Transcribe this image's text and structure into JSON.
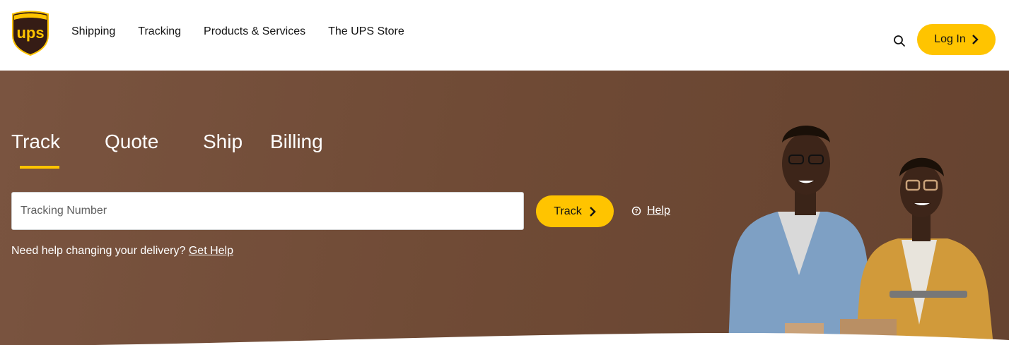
{
  "header": {
    "logo_text": "ups",
    "nav": [
      "Shipping",
      "Tracking",
      "Products & Services",
      "The UPS Store"
    ],
    "search_icon": "search-icon",
    "login_label": "Log In"
  },
  "hero": {
    "tabs": [
      "Track",
      "Quote",
      "Ship",
      "Billing"
    ],
    "active_tab": "Track",
    "tracking_placeholder": "Tracking Number",
    "track_button": "Track",
    "help_label": "Help",
    "delivery_prompt": "Need help changing your delivery?",
    "get_help_link": "Get Help"
  },
  "colors": {
    "brand_gold": "#ffc400",
    "brand_brown": "#6f4a35",
    "logo_brown": "#351c15"
  }
}
